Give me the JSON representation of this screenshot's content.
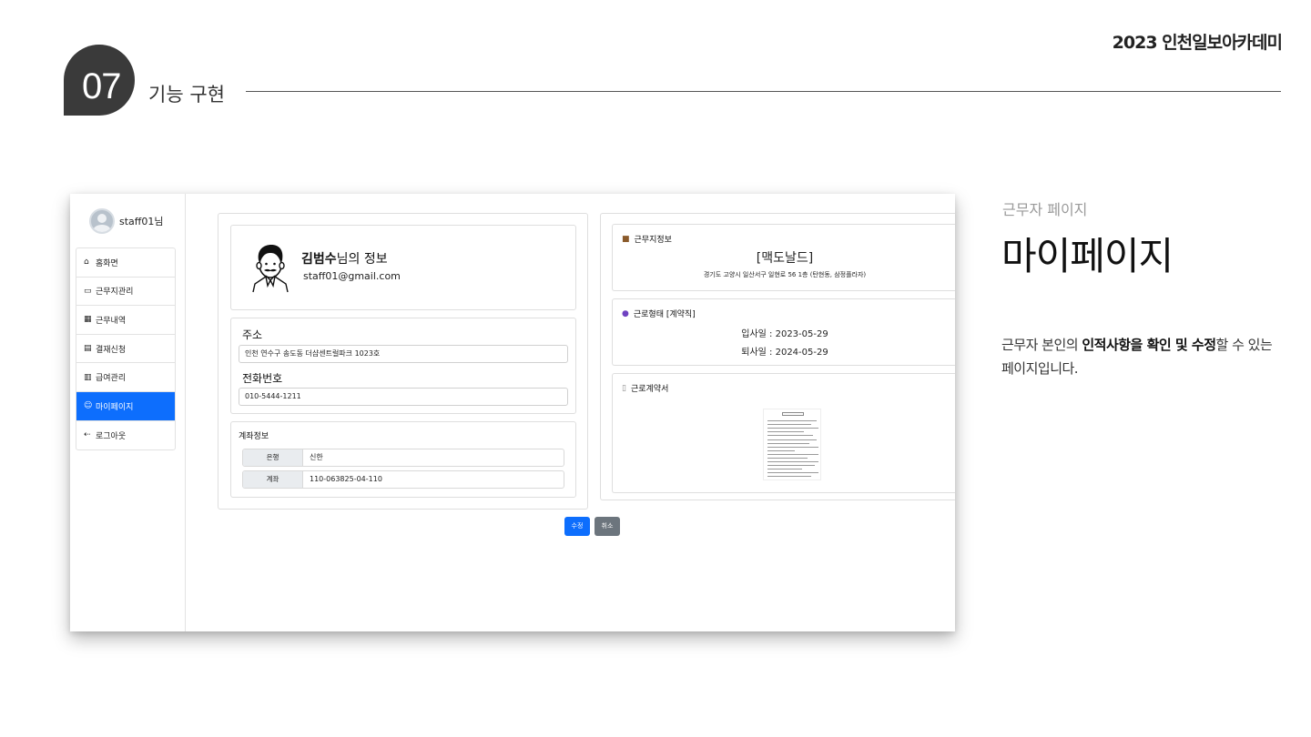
{
  "header": {
    "academy": "2023 인천일보아카데미",
    "section_number": "07",
    "section_title": "기능 구현"
  },
  "description": {
    "subtitle": "근무자 페이지",
    "title": "마이페이지",
    "body_pre": "근무자 본인의 ",
    "body_bold": "인적사항을 확인 및 수정",
    "body_post": "할 수 있는 페이지입니다."
  },
  "app": {
    "user": "staff01님",
    "menu": [
      {
        "icon": "home-icon",
        "glyph": "⌂",
        "label": "홈화면"
      },
      {
        "icon": "briefcase-icon",
        "glyph": "▭",
        "label": "근무지관리"
      },
      {
        "icon": "calendar-icon",
        "glyph": "▦",
        "label": "근무내역"
      },
      {
        "icon": "card-icon",
        "glyph": "▤",
        "label": "결재신청"
      },
      {
        "icon": "calculator-icon",
        "glyph": "▥",
        "label": "급여관리"
      },
      {
        "icon": "people-icon",
        "glyph": "☺",
        "label": "마이페이지"
      },
      {
        "icon": "logout-icon",
        "glyph": "⇠",
        "label": "로그아웃"
      }
    ],
    "active_menu_index": 5,
    "profile": {
      "name": "김범수",
      "name_suffix": "님의 정보",
      "email": "staff01@gmail.com"
    },
    "address": {
      "label": "주소",
      "value": "인천 연수구 송도동 더샵센트럴파크 1023호"
    },
    "phone": {
      "label": "전화번호",
      "value": "010-5444-1211"
    },
    "account": {
      "title": "계좌정보",
      "rows": [
        {
          "key": "은행",
          "value": "신한"
        },
        {
          "key": "계좌",
          "value": "110-063825-04-110"
        }
      ]
    },
    "workplace": {
      "title": "근무지정보",
      "name": "[맥도날드]",
      "address": "경기도 고양시 일산서구 일현로 56 1층 (탄현동, 삼정플라자)"
    },
    "employment": {
      "title": "근로형태 [계약직]",
      "start": "입사일 : 2023-05-29",
      "end": "퇴사일 : 2024-05-29"
    },
    "contract": {
      "title": "근로계약서"
    },
    "buttons": {
      "edit": "수정",
      "cancel": "취소"
    },
    "colors": {
      "primary": "#0d6efd",
      "secondary": "#6c757d"
    }
  }
}
